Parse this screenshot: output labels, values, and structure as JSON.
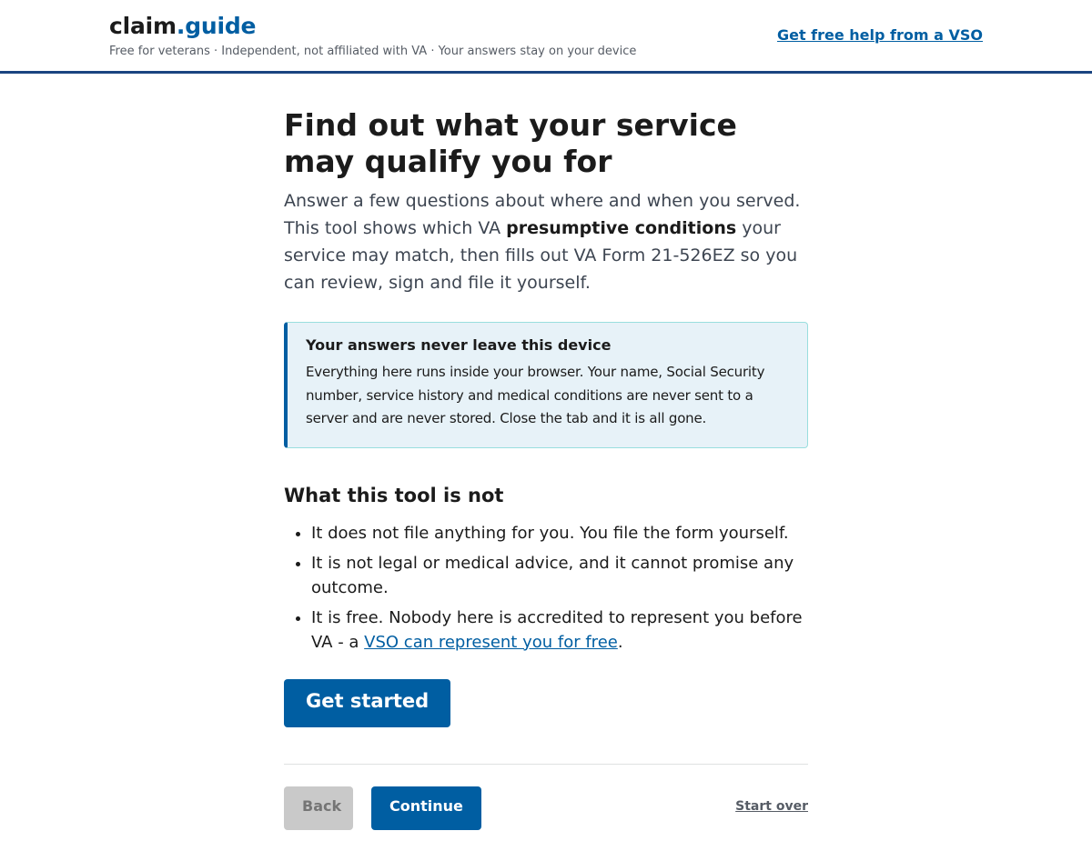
{
  "header": {
    "brand_part1": "claim",
    "brand_part2": ".guide",
    "tagline": "Free for veterans · Independent, not affiliated with VA · Your answers stay on your device",
    "help_link": "Get free help from a VSO"
  },
  "main": {
    "title": "Find out what your service may qualify you for",
    "intro_before": "Answer a few questions about where and when you served. This tool shows which VA ",
    "intro_bold": "presumptive conditions",
    "intro_after": " your service may match, then fills out VA Form 21-526EZ so you can review, sign and file it yourself.",
    "callout": {
      "title": "Your answers never leave this device",
      "body": "Everything here runs inside your browser. Your name, Social Security number, service history and medical conditions are never sent to a server and are never stored. Close the tab and it is all gone."
    },
    "not_heading": "What this tool is not",
    "not_items": [
      "It does not file anything for you. You file the form yourself.",
      "It is not legal or medical advice, and it cannot promise any outcome.",
      "It is free. Nobody here is accredited to represent you before VA - a "
    ],
    "vso_link": "VSO can represent you for free",
    "vso_after": ".",
    "get_started": "Get started"
  },
  "nav": {
    "back": "Back",
    "continue": "Continue",
    "start_over": "Start over"
  },
  "colors": {
    "accent": "#005ea2",
    "header_border": "#1a4480",
    "callout_bg": "#e7f2f8"
  }
}
